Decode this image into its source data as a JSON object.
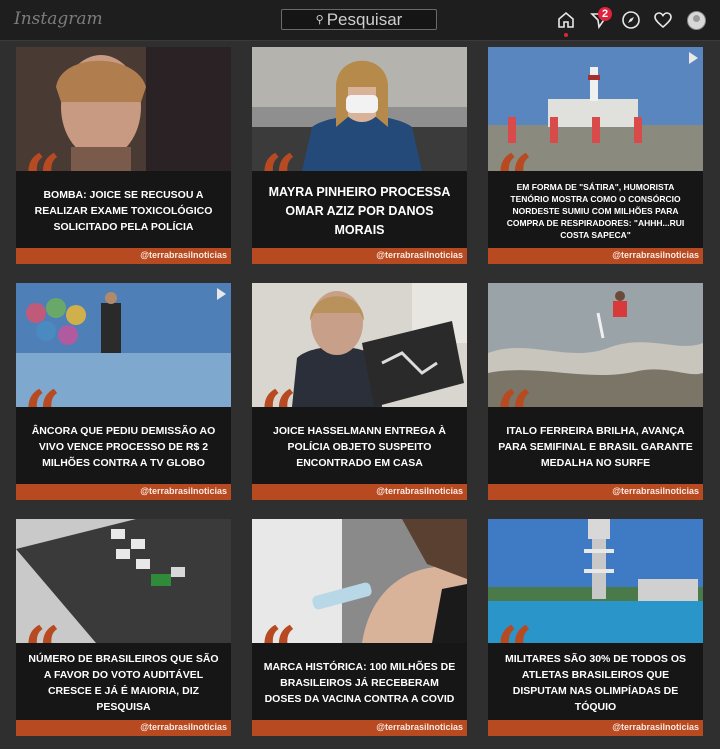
{
  "header": {
    "logo": "Instagram",
    "search_placeholder": "Pesquisar",
    "direct_badge": "2"
  },
  "icons": [
    "home-icon",
    "direct-icon",
    "explore-icon",
    "heart-icon",
    "avatar"
  ],
  "colors": {
    "accent": "#b84a22",
    "badge": "#e0233d"
  },
  "posts": [
    {
      "headline": "BOMBA: JOICE SE RECUSOU A REALIZAR EXAME TOXICOLÓGICO SOLICITADO PELA POLÍCIA",
      "handle": "@terrabrasilnoticias",
      "video": false
    },
    {
      "headline": "MAYRA PINHEIRO PROCESSA OMAR AZIZ POR DANOS MORAIS",
      "handle": "@terrabrasilnoticias",
      "video": false
    },
    {
      "headline": "EM FORMA DE \"SÁTIRA\", HUMORISTA TENÓRIO MOSTRA COMO O CONSÓRCIO NORDESTE SUMIU COM MILHÕES PARA COMPRA DE RESPIRADORES: \"AHHH...RUI COSTA SAPECA\"",
      "handle": "@terrabrasilnoticias",
      "video": true
    },
    {
      "headline": "ÂNCORA QUE PEDIU DEMISSÃO AO VIVO VENCE PROCESSO DE R$ 2 MILHÕES CONTRA A TV GLOBO",
      "handle": "@terrabrasilnoticias",
      "video": true
    },
    {
      "headline": "JOICE HASSELMANN ENTREGA À POLÍCIA OBJETO SUSPEITO ENCONTRADO EM CASA",
      "handle": "@terrabrasilnoticias",
      "video": false
    },
    {
      "headline": "ITALO FERREIRA BRILHA, AVANÇA PARA SEMIFINAL E BRASIL GARANTE MEDALHA NO SURFE",
      "handle": "@terrabrasilnoticias",
      "video": false
    },
    {
      "headline": "NÚMERO DE BRASILEIROS QUE SÃO A FAVOR DO VOTO AUDITÁVEL CRESCE E JÁ É MAIORIA, DIZ PESQUISA",
      "handle": "@terrabrasilnoticias",
      "video": false
    },
    {
      "headline": "MARCA HISTÓRICA: 100 MILHÕES DE BRASILEIROS JÁ RECEBERAM DOSES DA VACINA CONTRA A COVID",
      "handle": "@terrabrasilnoticias",
      "video": false
    },
    {
      "headline": "MILITARES SÃO 30% DE TODOS OS ATLETAS BRASILEIROS QUE DISPUTAM NAS OLIMPÍADAS DE TÓQUIO",
      "handle": "@terrabrasilnoticias",
      "video": false
    }
  ]
}
